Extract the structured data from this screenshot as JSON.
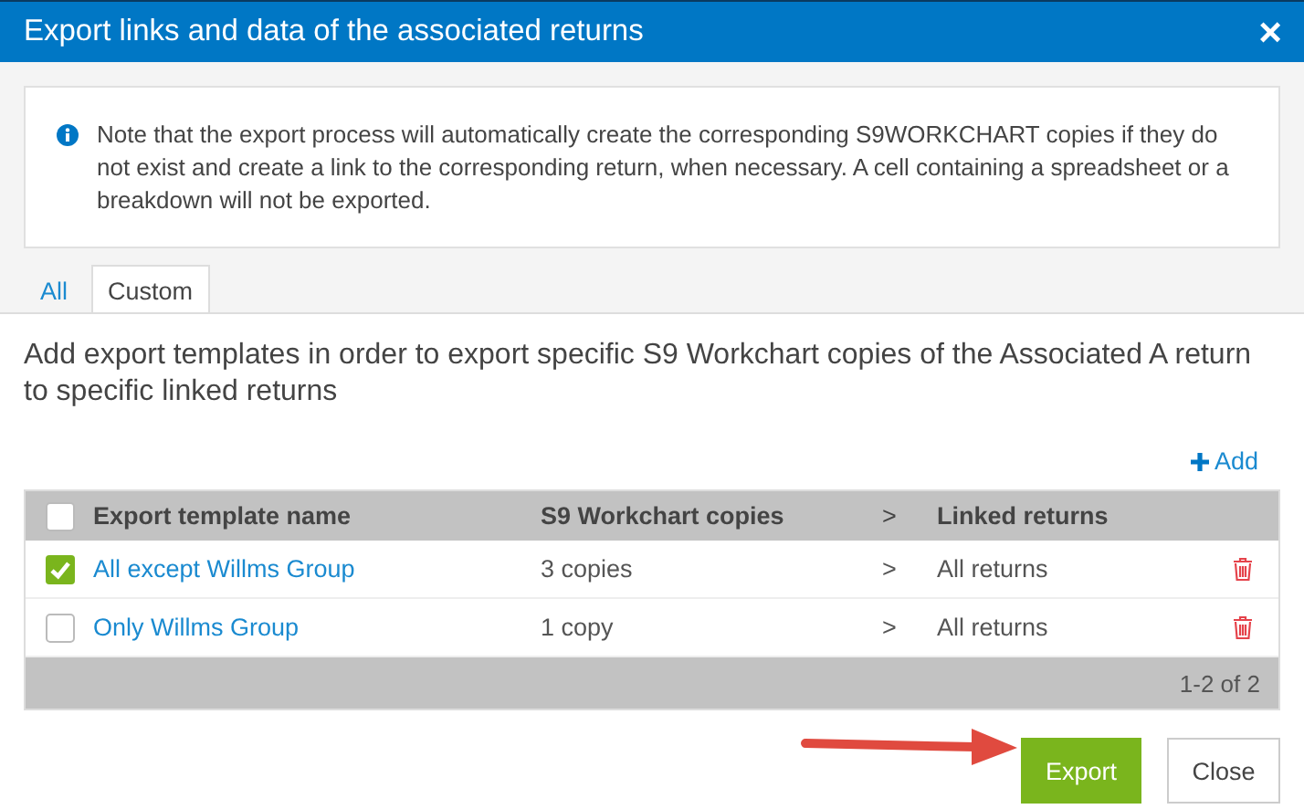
{
  "window": {
    "title": "Export links and data of the associated returns",
    "close": "×"
  },
  "notice": "Note that the export process will automatically create the corresponding S9WORKCHART copies if they do not exist and create a link to the corresponding return, when necessary. A cell containing a spreadsheet or a breakdown will not be exported.",
  "tabs": [
    {
      "label": "All",
      "selected": false
    },
    {
      "label": "Custom",
      "selected": true
    }
  ],
  "description": "Add export templates in order to export specific S9 Workchart copies of the Associated A return to specific linked returns",
  "add_button": "Add",
  "table": {
    "select_all": false,
    "columns": [
      "Export template name",
      "S9 Workchart copies",
      ">",
      "Linked returns"
    ],
    "rows": [
      {
        "checked": true,
        "name": "All except Willms Group",
        "copies": "3 copies",
        "chevron": ">",
        "linked": "All returns"
      },
      {
        "checked": false,
        "name": "Only Willms Group",
        "copies": "1 copy",
        "chevron": ">",
        "linked": "All returns"
      }
    ],
    "pagination": "1-2 of 2"
  },
  "buttons": [
    {
      "kind": "primary",
      "label": "Export"
    },
    {
      "kind": "secondary",
      "label": "Close"
    }
  ]
}
